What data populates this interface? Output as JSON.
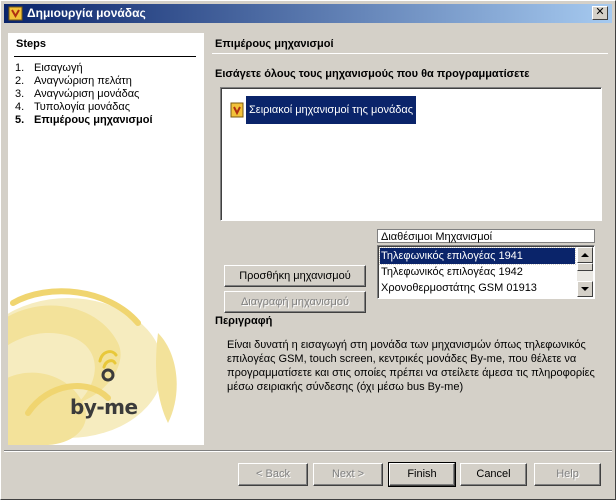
{
  "window": {
    "title": "Δημιουργία μονάδας",
    "close_glyph": "✕"
  },
  "steps": {
    "title": "Steps",
    "items": [
      {
        "num": "1.",
        "label": "Εισαγωγή"
      },
      {
        "num": "2.",
        "label": "Αναγνώριση πελάτη"
      },
      {
        "num": "3.",
        "label": "Αναγνώριση μονάδας"
      },
      {
        "num": "4.",
        "label": "Τυπολογία μονάδας"
      },
      {
        "num": "5.",
        "label": "Επιμέρους μηχανισμοί"
      }
    ],
    "current_index": 4
  },
  "logo": {
    "text": "by-me",
    "accent_color": "#e8c83a"
  },
  "main": {
    "title": "Επιμέρους μηχανισμοί",
    "instruction": "Εισάγετε όλους τους μηχανισμούς που θα προγραμματίσετε",
    "tree": {
      "root_label": "Σειριακοί μηχανισμοί της μονάδας",
      "root_icon": "device-icon"
    },
    "add_button": "Προσθήκη μηχανισμού",
    "delete_button": "Διαγραφή μηχανισμού",
    "available": {
      "header": "Διαθέσιμοι Μηχανισμοί",
      "items": [
        "Τηλεφωνικός επιλογέας 1941",
        "Τηλεφωνικός επιλογέας 1942",
        "Χρονοθερμοστάτης GSM 01913"
      ],
      "selected_index": 0
    },
    "description": {
      "title": "Περιγραφή",
      "text": "Είναι δυνατή η εισαγωγή στη μονάδα των μηχανισμών όπως τηλεφωνικός επιλογέας GSM, touch screen, κεντρικές μονάδες By-me, που θέλετε να προγραμματίσετε και στις οποίες πρέπει να στείλετε άμεσα τις πληροφορίες μέσω σειριακής σύνδεσης (όχι μέσω bus By-me)"
    }
  },
  "footer": {
    "back": "< Back",
    "next": "Next >",
    "finish": "Finish",
    "cancel": "Cancel",
    "help": "Help"
  },
  "colors": {
    "selection": "#0a246a",
    "face": "#d4d0c8"
  }
}
